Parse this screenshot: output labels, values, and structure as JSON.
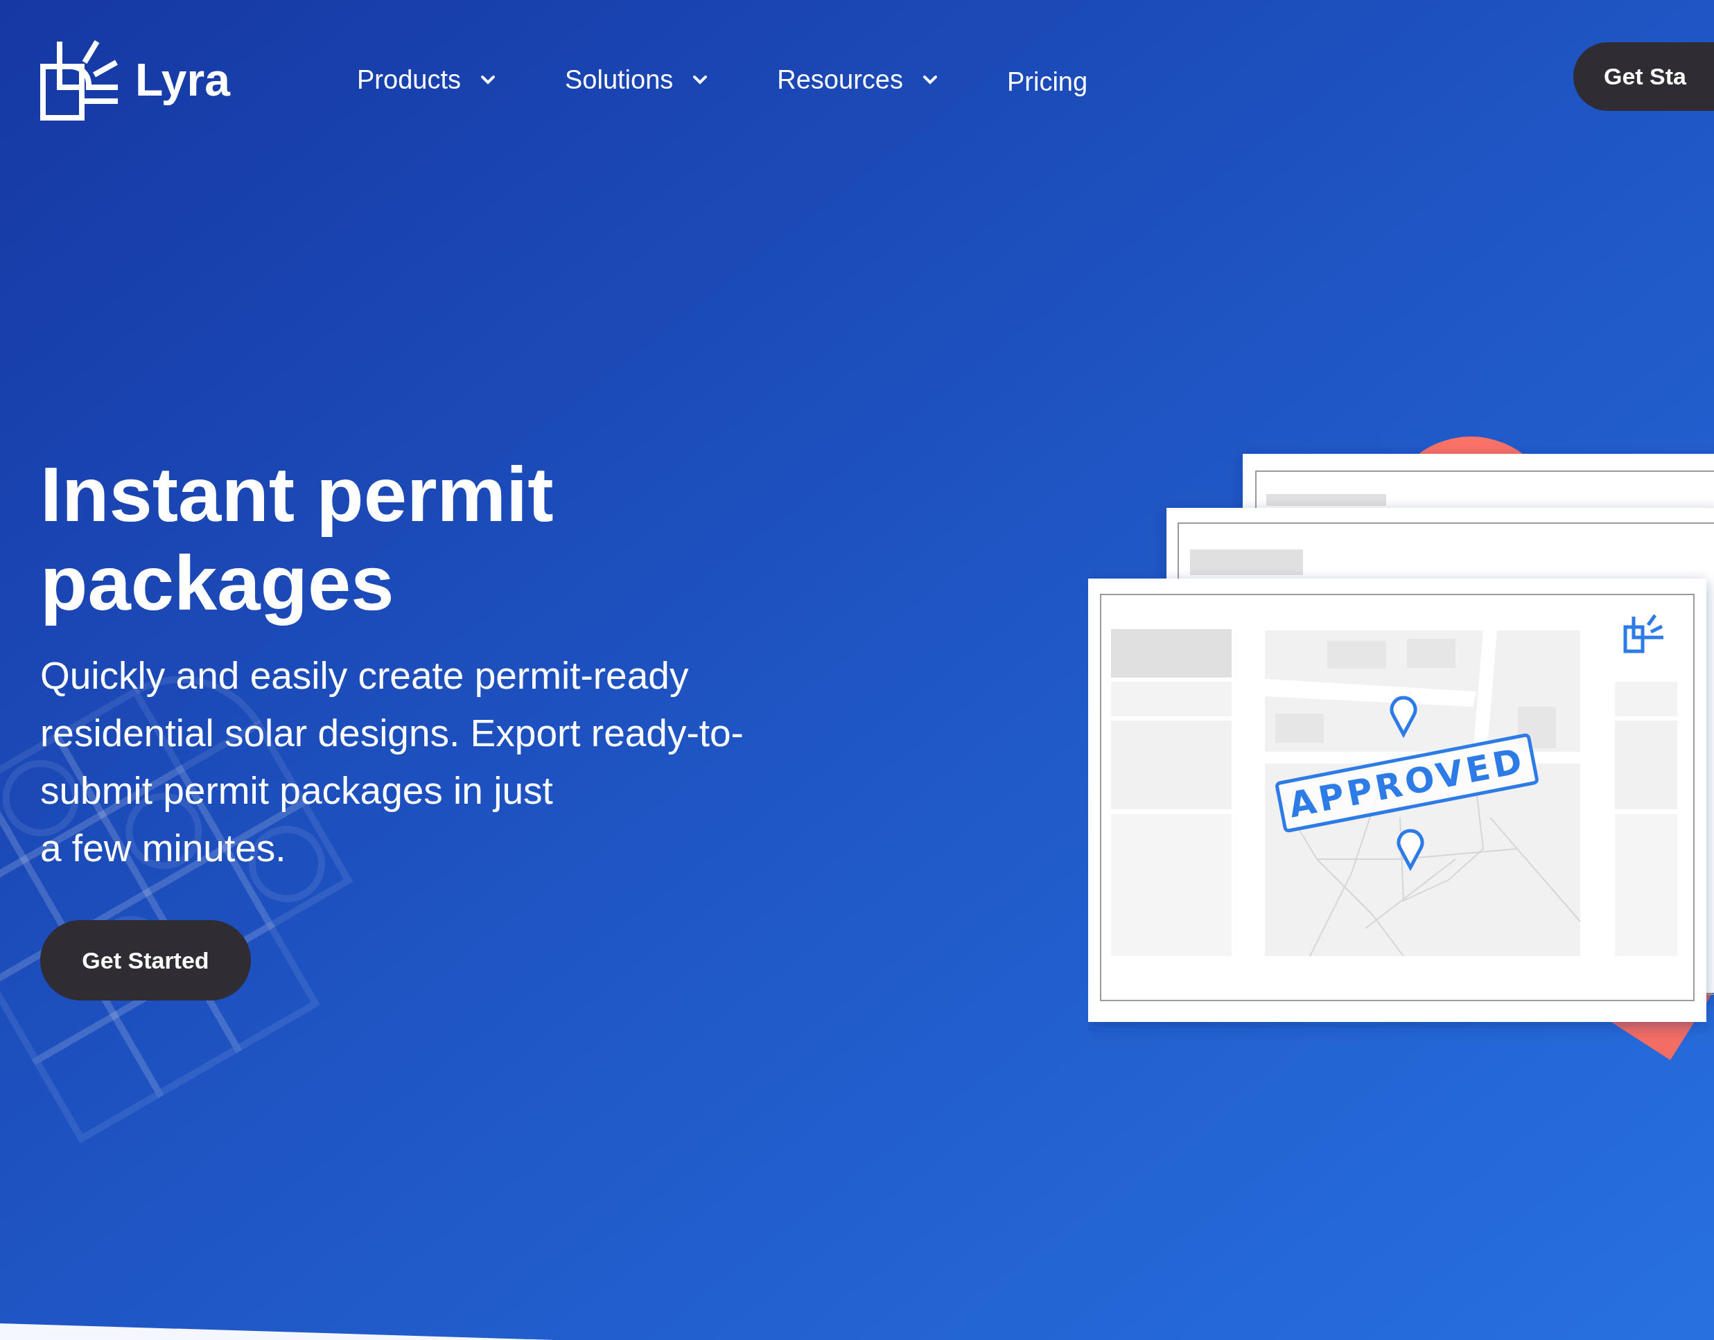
{
  "header": {
    "logo": "Lyra",
    "nav": [
      {
        "label": "Products",
        "dropdown": true
      },
      {
        "label": "Solutions",
        "dropdown": true
      },
      {
        "label": "Resources",
        "dropdown": true
      },
      {
        "label": "Pricing",
        "dropdown": false
      }
    ],
    "cta": "Get Sta"
  },
  "hero": {
    "title": "Instant permit packages",
    "description_lines": [
      "Quickly and easily create permit-ready",
      "residential solar designs. Export ready-to-",
      "submit permit packages in just",
      "a few minutes."
    ],
    "button": "Get Started",
    "illustration": {
      "stamp": "APPROVED"
    }
  }
}
